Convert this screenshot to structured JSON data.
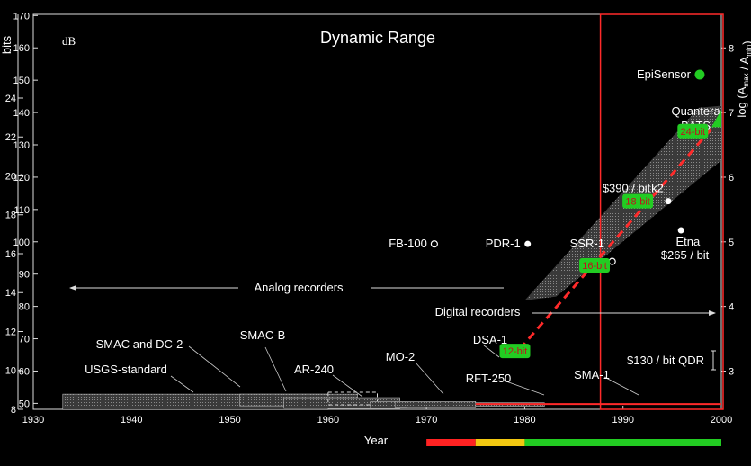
{
  "chart_data": {
    "type": "scatter",
    "title": "Dynamic Range",
    "xlabel": "Year",
    "ylabel_left": "bits",
    "ylabel_left_secondary": "dB",
    "ylabel_right": "log (A",
    "ylabel_right_parts": {
      "a": "log (A",
      "max": "max",
      "mid": " / A",
      "min": "min",
      "end": ")"
    },
    "xlim": [
      1930,
      2000
    ],
    "bits_lim": [
      8,
      28.3
    ],
    "x_ticks": [
      1930,
      1940,
      1950,
      1960,
      1970,
      1980,
      1990,
      2000
    ],
    "bits_ticks": [
      8,
      10,
      12,
      14,
      16,
      18,
      20,
      22,
      24
    ],
    "db_ticks": [
      50,
      60,
      70,
      80,
      90,
      100,
      110,
      120,
      130,
      140,
      150,
      160,
      170
    ],
    "log_ticks": [
      3,
      4,
      5,
      6,
      7,
      8
    ],
    "points": [
      {
        "name": "FB-100",
        "x": 1970.8,
        "bits": 16.5,
        "style": "open"
      },
      {
        "name": "PDR-1",
        "x": 1980.3,
        "bits": 16.5,
        "style": "filled"
      },
      {
        "name": "SSR-1",
        "x": 1988.9,
        "bits": 15.6,
        "style": "open"
      },
      {
        "name": "k2",
        "x": 1994.6,
        "bits": 18.7,
        "style": "filled"
      },
      {
        "name": "Etna",
        "x": 1995.9,
        "bits": 17.2,
        "style": "filled"
      },
      {
        "name": "EpiSensor",
        "x": 1997.8,
        "bits": 25.2,
        "style": "green"
      }
    ],
    "bit_badges": [
      {
        "text": "12-bit",
        "x": 1979.0,
        "bits": 11.0
      },
      {
        "text": "16-bit",
        "x": 1987.1,
        "bits": 15.4
      },
      {
        "text": "18-bit",
        "x": 1991.5,
        "bits": 18.7
      },
      {
        "text": "24-bit",
        "x": 1997.1,
        "bits": 22.3
      }
    ],
    "annotations": {
      "analog": "Analog recorders",
      "digital": "Digital recorders",
      "usgs": "USGS-standard",
      "smac_dc2": "SMAC and DC-2",
      "smacb": "SMAC-B",
      "ar240": "AR-240",
      "mo2": "MO-2",
      "rft250": "RFT-250",
      "sma1": "SMA-1",
      "dsa1": "DSA-1",
      "price390": "$390 / bit",
      "etna": "Etna",
      "price265": "$265 / bit",
      "quantera1": "Quantera",
      "quantera2": "BATS",
      "qdr": "$130 / bit QDR"
    },
    "period_colors": [
      "#ff2222",
      "#f2c811",
      "#22cc22"
    ],
    "accent_red": "#ff2a2a",
    "accent_green": "#22cc22"
  }
}
